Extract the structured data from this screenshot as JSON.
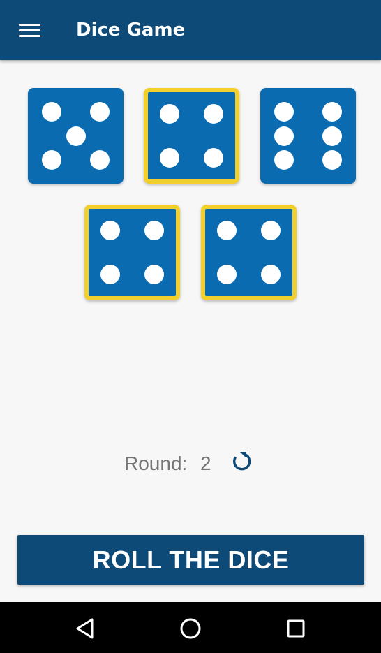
{
  "app_bar": {
    "title": "Dice Game",
    "menu_icon": "hamburger-menu-icon",
    "color": "#0d4a78"
  },
  "dice": [
    {
      "value": 5,
      "held": false
    },
    {
      "value": 4,
      "held": true
    },
    {
      "value": 6,
      "held": false
    },
    {
      "value": 4,
      "held": true
    },
    {
      "value": 4,
      "held": true
    }
  ],
  "colors": {
    "die_fill": "#0a6bb0",
    "held_border": "#f2cf2b",
    "pip": "#ffffff"
  },
  "round": {
    "label": "Round:",
    "value": "2",
    "reset_icon": "refresh-icon"
  },
  "roll_button": {
    "label": "ROLL THE DICE"
  },
  "nav_bar": {
    "back_icon": "back-triangle-icon",
    "home_icon": "home-circle-icon",
    "recents_icon": "recents-square-icon"
  }
}
